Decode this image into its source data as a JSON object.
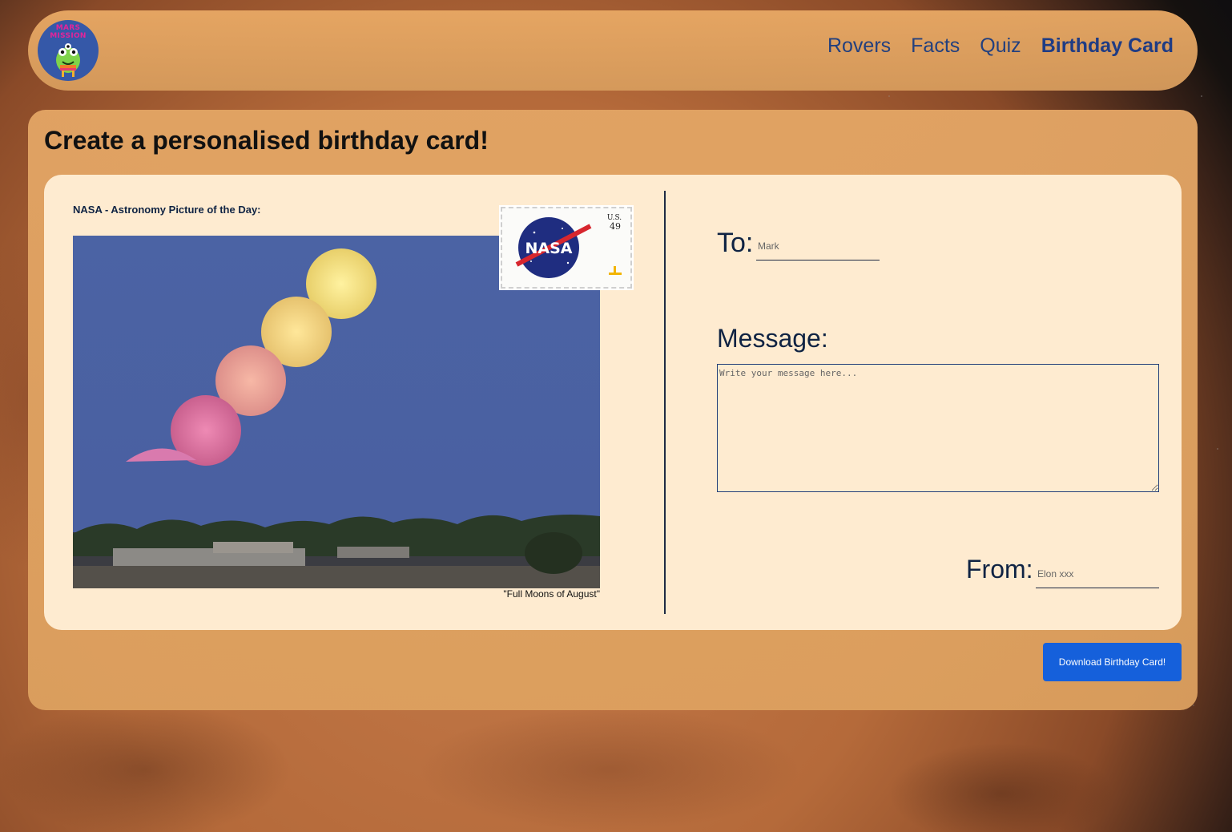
{
  "logo": {
    "text_line1": "MARS",
    "text_line2": "MISSION"
  },
  "nav": {
    "items": [
      {
        "label": "Rovers",
        "active": false
      },
      {
        "label": "Facts",
        "active": false
      },
      {
        "label": "Quiz",
        "active": false
      },
      {
        "label": "Birthday Card",
        "active": true
      }
    ]
  },
  "page": {
    "title": "Create a personalised birthday card!"
  },
  "card": {
    "apod_label": "NASA - Astronomy Picture of the Day:",
    "apod_caption": "\"Full Moons of August\"",
    "stamp": {
      "text": "NASA",
      "price": "49",
      "country": "U.S."
    },
    "to_label": "To:",
    "to_placeholder": "Mark",
    "message_label": "Message:",
    "message_placeholder": "Write your message here...",
    "from_label": "From:",
    "from_placeholder": "Elon xxx"
  },
  "download_button": "Download Birthday Card!",
  "colors": {
    "nav_link": "#23407e",
    "button": "#1560db",
    "card_bg": "#feebd0",
    "panel_bg": "#e2a464"
  }
}
